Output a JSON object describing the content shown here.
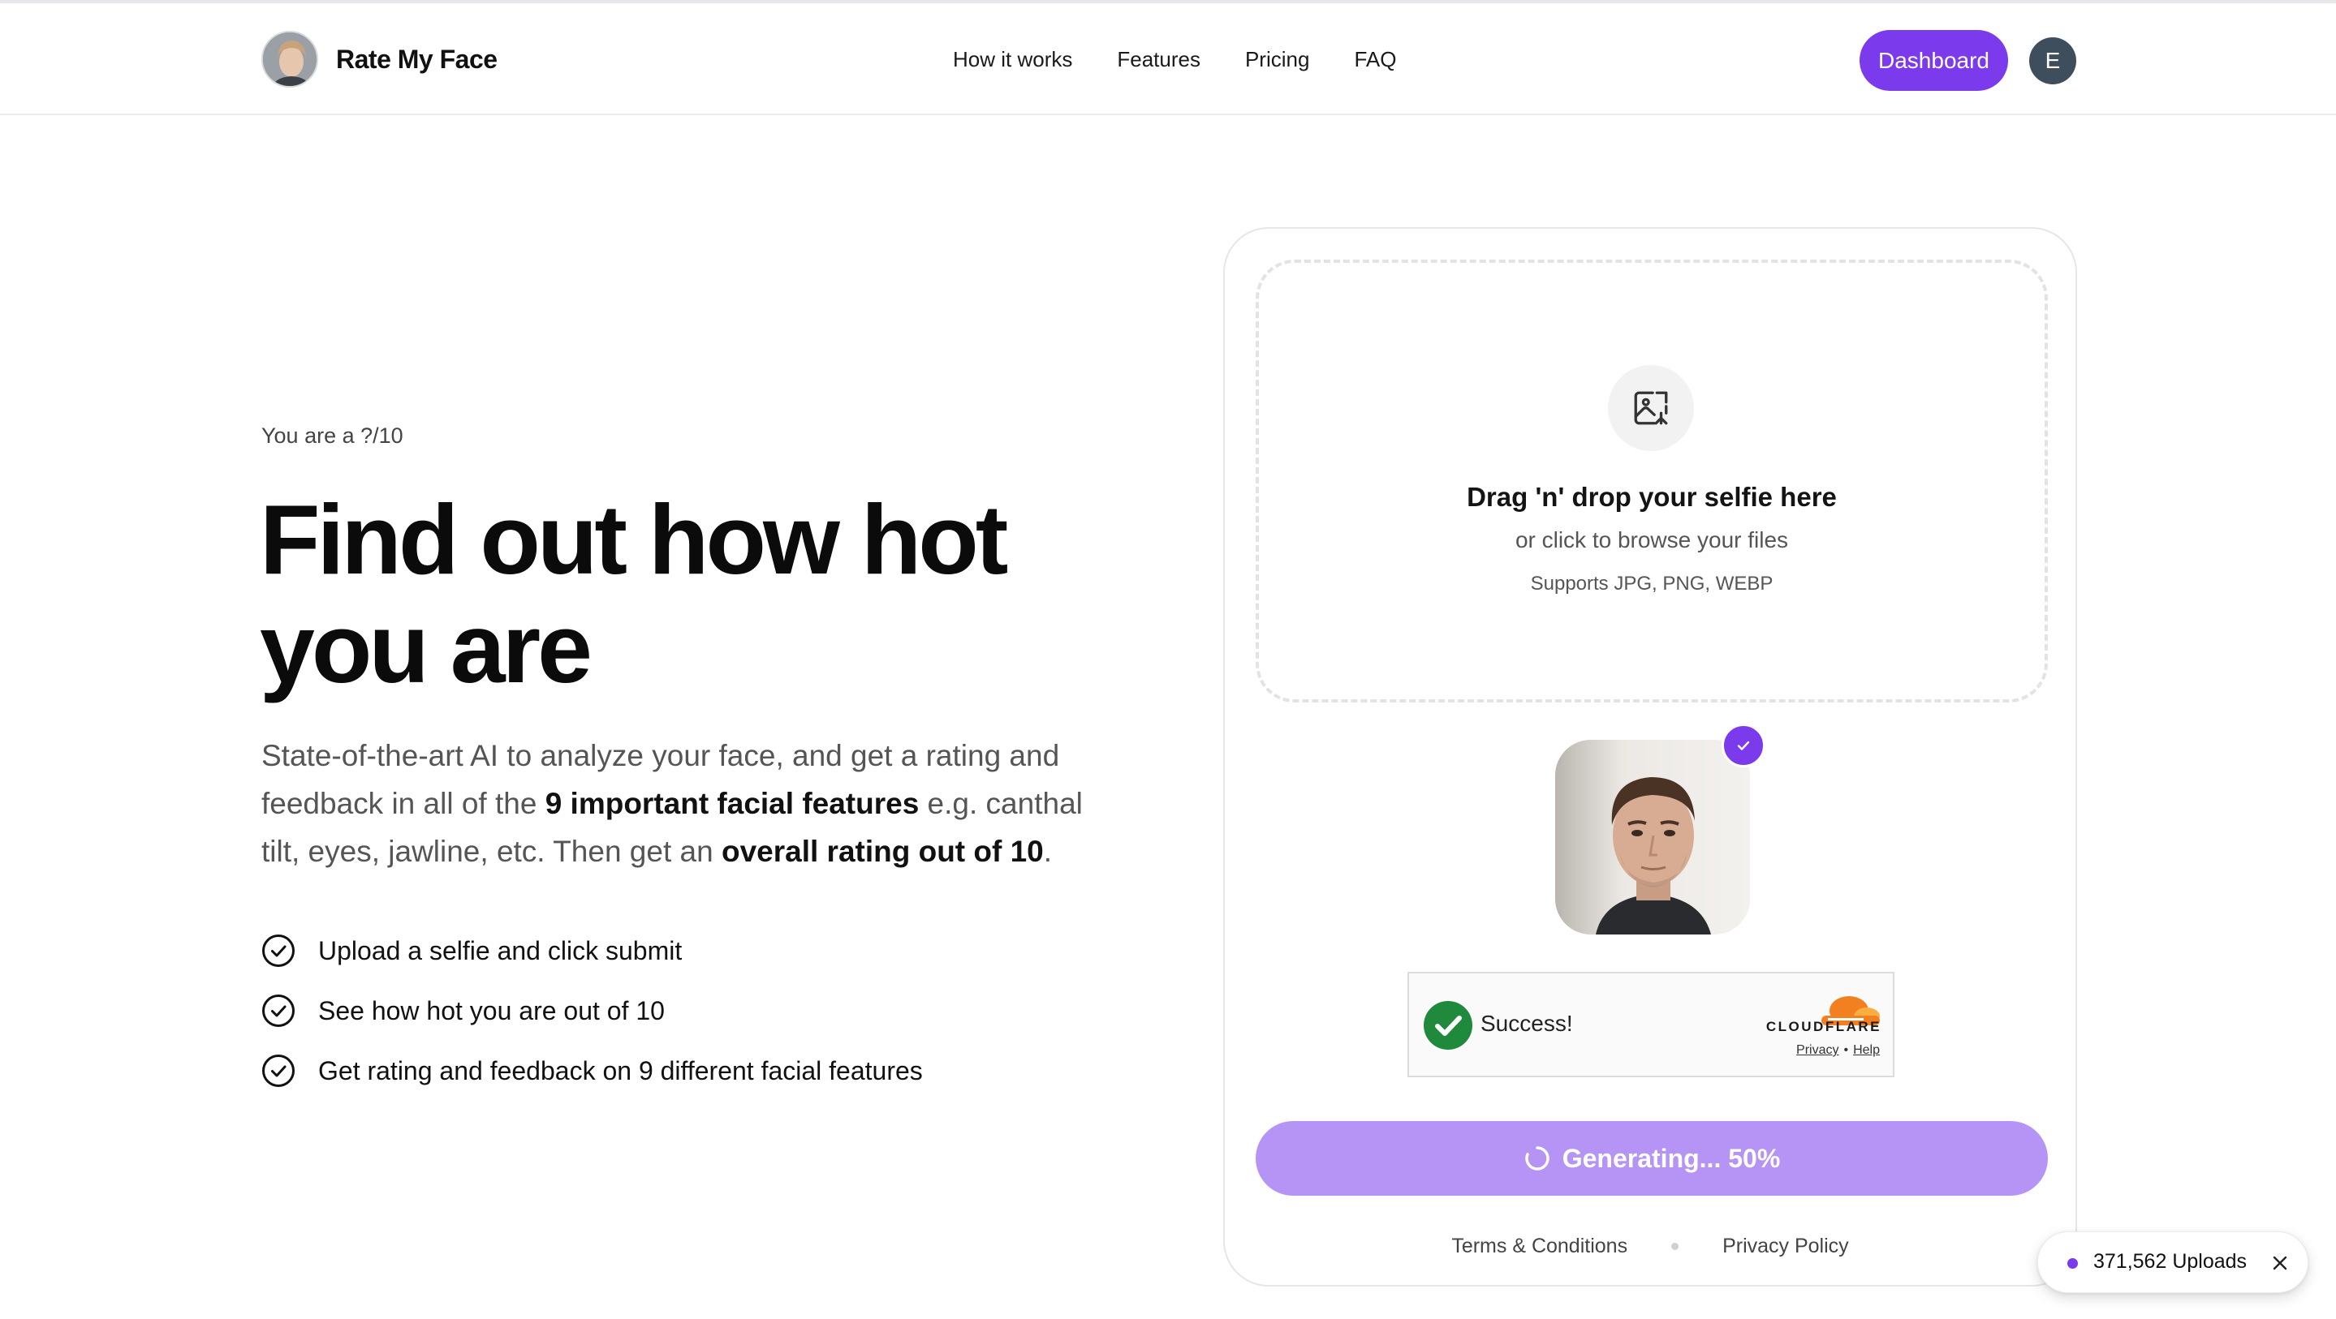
{
  "header": {
    "brand_name": "Rate My Face",
    "nav": [
      {
        "label": "How it works"
      },
      {
        "label": "Features"
      },
      {
        "label": "Pricing"
      },
      {
        "label": "FAQ"
      }
    ],
    "dashboard_label": "Dashboard",
    "user_initial": "E"
  },
  "hero": {
    "eyebrow": "You are a ?/10",
    "headline_line1": "Find out how hot",
    "headline_line2": "you are",
    "lead": {
      "part1": "State-of-the-art AI to analyze your face, and get a rating and feedback in all of the ",
      "bold1": "9 important facial features",
      "part2": " e.g. canthal tilt, eyes, jawline, etc. Then get an ",
      "bold2": "overall rating out of 10",
      "part3": "."
    },
    "checklist": [
      {
        "text": "Upload a selfie and click submit"
      },
      {
        "text": "See how hot you are out of 10"
      },
      {
        "text": "Get rating and feedback on 9 different facial features"
      }
    ]
  },
  "upload": {
    "title": "Drag 'n' drop your selfie here",
    "subtitle": "or click to browse your files",
    "formats": "Supports JPG, PNG, WEBP"
  },
  "turnstile": {
    "status": "Success!",
    "brand": "CLOUDFLARE",
    "privacy": "Privacy",
    "separator": "•",
    "help": "Help"
  },
  "generate": {
    "label": "Generating... 50%",
    "progress_percent": 50
  },
  "footer_links": {
    "terms": "Terms & Conditions",
    "privacy": "Privacy Policy"
  },
  "toast": {
    "text": "371,562 Uploads"
  },
  "colors": {
    "accent": "#7c3aed",
    "accent_light": "#b594f5",
    "success": "#1f8a3b",
    "cloudflare_orange": "#f38020"
  }
}
